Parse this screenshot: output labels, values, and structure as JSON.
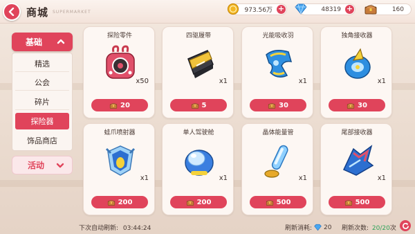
{
  "header": {
    "title": "商城",
    "subtitle": "SUPERMARKET",
    "gold": "973.56万",
    "diamond": "48319",
    "chest": "160"
  },
  "sidebar": {
    "group1": "基础",
    "items": [
      "精选",
      "公会",
      "碎片",
      "探险器",
      "饰品商店"
    ],
    "active_index": 3,
    "group2": "活动"
  },
  "items": [
    {
      "name": "探险零件",
      "qty": "x50",
      "price": "20",
      "icon": "parts-bag-icon"
    },
    {
      "name": "四驱履带",
      "qty": "x1",
      "price": "5",
      "icon": "track-icon"
    },
    {
      "name": "光能吸收羽",
      "qty": "x1",
      "price": "30",
      "icon": "wing-icon"
    },
    {
      "name": "独角接收器",
      "qty": "x1",
      "price": "30",
      "icon": "unicorn-receiver-icon"
    },
    {
      "name": "蛙爪喷射器",
      "qty": "x1",
      "price": "200",
      "icon": "claw-jet-icon"
    },
    {
      "name": "单人驾驶舱",
      "qty": "x1",
      "price": "200",
      "icon": "cockpit-icon"
    },
    {
      "name": "晶体能量管",
      "qty": "x1",
      "price": "500",
      "icon": "crystal-tube-icon"
    },
    {
      "name": "尾部接收器",
      "qty": "x1",
      "price": "500",
      "icon": "tail-receiver-icon"
    }
  ],
  "footer": {
    "auto_refresh_label": "下次自动刷新:",
    "auto_refresh_time": "03:44:24",
    "refresh_cost_label": "刷新消耗:",
    "refresh_cost": "20",
    "refresh_count_label": "刷新次数:",
    "refresh_count": "20/20",
    "refresh_unit": "次"
  },
  "colors": {
    "accent": "#e0445b",
    "card_bg": "#fdf7f3",
    "page_bg": "#ede0d6"
  }
}
